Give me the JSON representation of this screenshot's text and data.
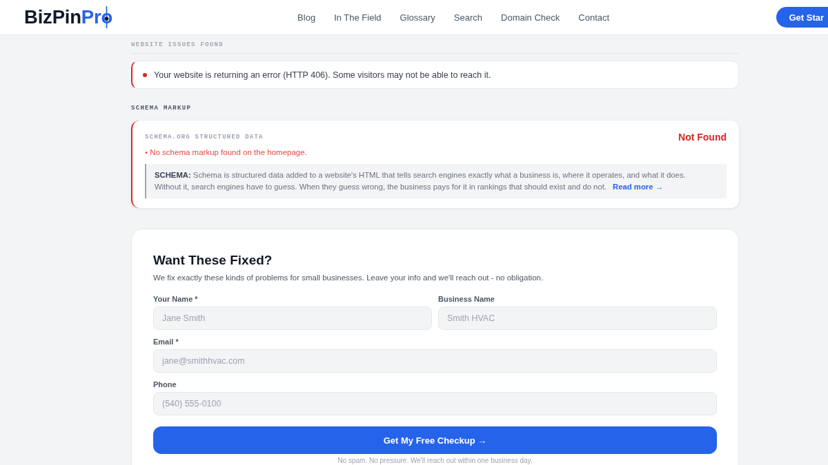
{
  "header": {
    "logo": {
      "text": "BizPin",
      "accent": "Pro"
    },
    "nav": [
      {
        "label": "Blog"
      },
      {
        "label": "In The Field"
      },
      {
        "label": "Glossary"
      },
      {
        "label": "Search"
      },
      {
        "label": "Domain Check"
      },
      {
        "label": "Contact"
      }
    ],
    "cta": "Get Star"
  },
  "issues_section": {
    "heading": "WEBSITE ISSUES FOUND",
    "issues": [
      {
        "text": "Your website is returning an error (HTTP 406). Some visitors may not be able to reach it."
      }
    ]
  },
  "schema_section": {
    "heading": "SCHEMA MARKUP",
    "checks": [
      {
        "title": "SCHEMA.ORG STRUCTURED DATA",
        "passed": false,
        "status": "Not Found",
        "finding": "• No schema markup found on the homepage.",
        "definition": "**SCHEMA:** Schema is structured data added to a website's HTML that tells search engines exactly what a business is, where it operates, and what it does. Without it, search engines have to guess. When they guess wrong, the business pays for it in rankings that should exist and do not.",
        "link": "Read more →"
      }
    ]
  },
  "form": {
    "title": "Want These Fixed?",
    "subtitle": "We fix exactly these kinds of problems for small businesses. Leave your info and we'll reach out - no obligation.",
    "rows": [
      [
        {
          "label": "Your Name *",
          "placeholder": "Jane Smith"
        },
        {
          "label": "Business Name",
          "placeholder": "Smith HVAC"
        }
      ],
      [
        {
          "label": "Email *",
          "placeholder": "jane@smithhvac.com"
        }
      ],
      [
        {
          "label": "Phone",
          "placeholder": "(540) 555-0100"
        }
      ]
    ],
    "submit": "Get My Free Checkup →",
    "note": "No spam. No pressure. We'll reach out within one business day."
  }
}
